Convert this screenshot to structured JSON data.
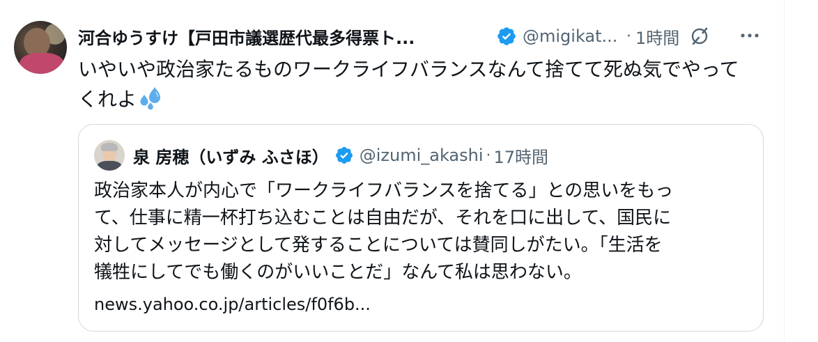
{
  "post": {
    "author_name": "河合ゆうすけ【戸田市議選歴代最多得票ト...",
    "handle": "@migikat...",
    "separator": "·",
    "time": "1時間",
    "text_line1": "いやいや政治家たるものワークライフバランスなんて捨てて死ぬ気でやって",
    "text_line2": "くれよ",
    "emoji": "sweat-droplets"
  },
  "quote": {
    "author_name": "泉 房穂（いずみ ふさほ）",
    "handle": "@izumi_akashi",
    "separator": "·",
    "time": "17時間",
    "lines": [
      "政治家本人が内心で「ワークライフバランスを捨てる」との思いをもっ",
      "て、仕事に精一杯打ち込むことは自由だが、それを口に出して、国民に",
      "対してメッセージとして発することについては賛同しがたい。「生活を",
      "犠牲にしてでも働くのがいいことだ」なんて私は思わない。"
    ],
    "link": "news.yahoo.co.jp/articles/f0f6b..."
  },
  "colors": {
    "verified": "#1d9bf0",
    "secondary_text": "#536471",
    "border": "#cfd9de"
  },
  "icons": [
    "avatar",
    "verified-badge-icon",
    "grok-icon",
    "more-icon",
    "sweat-droplets-icon"
  ]
}
